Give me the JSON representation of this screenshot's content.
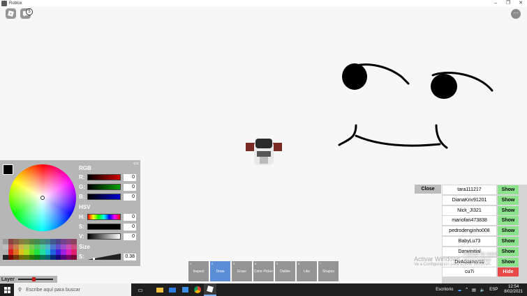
{
  "window": {
    "title": "Roblox",
    "buttons": [
      "–",
      "❐",
      "✕"
    ]
  },
  "top": {
    "chat_badge": "5"
  },
  "color_panel": {
    "collapse": "<<",
    "rgb_label": "RGB",
    "hsv_label": "HSV",
    "size_label": "Size",
    "rows": [
      {
        "key": "R:",
        "value": "0",
        "color": "#c00000"
      },
      {
        "key": "G:",
        "value": "0",
        "color": "#009000"
      },
      {
        "key": "B:",
        "value": "0",
        "color": "#0000c0"
      },
      {
        "key": "H:",
        "value": "0",
        "color": "hue"
      },
      {
        "key": "S:",
        "value": "0",
        "color": "#000000"
      },
      {
        "key": "V:",
        "value": "0",
        "color": "gradient"
      },
      {
        "key": "S:",
        "value": "0.38",
        "color": "size"
      }
    ],
    "layer_label": "Layer"
  },
  "tools": [
    {
      "num": "1",
      "label": "Inspect"
    },
    {
      "num": "2",
      "label": "Draw",
      "active": true
    },
    {
      "num": "3",
      "label": "Erase"
    },
    {
      "num": "4",
      "label": "Color Picker"
    },
    {
      "num": "5",
      "label": "Dislike"
    },
    {
      "num": "6",
      "label": "Like"
    },
    {
      "num": "7",
      "label": "Shapes"
    }
  ],
  "players": {
    "close_label": "Close",
    "list": [
      {
        "name": "tara111217",
        "action": "Show"
      },
      {
        "name": "DianaKriv91201",
        "action": "Show"
      },
      {
        "name": "Nick_JI321",
        "action": "Show"
      },
      {
        "name": "mariofan473838",
        "action": "Show"
      },
      {
        "name": "pedrodenginho008",
        "action": "Show"
      },
      {
        "name": "BabyLu73",
        "action": "Show"
      },
      {
        "name": "Darwinitial",
        "action": "Show"
      },
      {
        "name": "DvAGamer16",
        "action": "Show"
      },
      {
        "name": "cu7i",
        "action": "Hide"
      }
    ]
  },
  "toast": "Failed to save screenshot",
  "activate_windows": {
    "line1": "Activar Windows",
    "line2": "Ve a Configuración para activar Windows."
  },
  "taskbar": {
    "search_placeholder": "Escribe aquí para buscar",
    "desktop_label": "Escritorio",
    "lang": "ESP",
    "time": "12:54",
    "date": "8/02/2021"
  }
}
